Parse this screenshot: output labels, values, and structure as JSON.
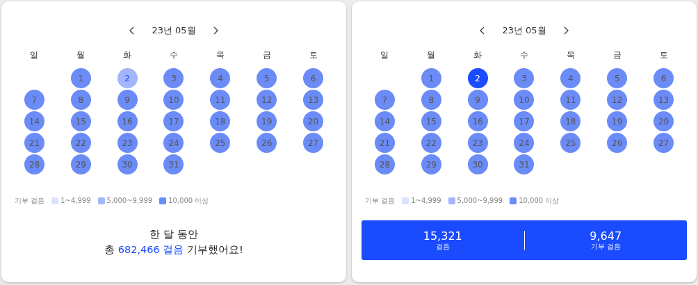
{
  "panels": [
    {
      "month": "23년 05월",
      "weekdays": [
        "일",
        "월",
        "화",
        "수",
        "목",
        "금",
        "토"
      ],
      "weeks": [
        [
          {
            "label": "1",
            "color": "#6b8bf7",
            "selected": false,
            "today": false
          },
          {
            "label": "2",
            "color": "#a3b5fb",
            "selected": false,
            "today": true
          },
          {
            "label": "3",
            "color": "#6b8bf7",
            "selected": false,
            "today": false
          },
          {
            "label": "4",
            "color": "#6b8bf7",
            "selected": false,
            "today": false
          },
          {
            "label": "5",
            "color": "#6b8bf7",
            "selected": false,
            "today": false
          },
          {
            "label": "6",
            "color": "#6b8bf7",
            "selected": false,
            "today": false
          }
        ],
        [
          {
            "label": "7",
            "color": "#6b8bf7",
            "selected": false,
            "today": false
          },
          {
            "label": "8",
            "color": "#6b8bf7",
            "selected": false,
            "today": false
          },
          {
            "label": "9",
            "color": "#6b8bf7",
            "selected": false,
            "today": false
          },
          {
            "label": "10",
            "color": "#6b8bf7",
            "selected": false,
            "today": false
          },
          {
            "label": "11",
            "color": "#6b8bf7",
            "selected": false,
            "today": false
          },
          {
            "label": "12",
            "color": "#6b8bf7",
            "selected": false,
            "today": false
          },
          {
            "label": "13",
            "color": "#6b8bf7",
            "selected": false,
            "today": false
          }
        ],
        [
          {
            "label": "14",
            "color": "#6b8bf7",
            "selected": false,
            "today": false
          },
          {
            "label": "15",
            "color": "#6b8bf7",
            "selected": false,
            "today": false
          },
          {
            "label": "16",
            "color": "#6b8bf7",
            "selected": false,
            "today": false
          },
          {
            "label": "17",
            "color": "#6b8bf7",
            "selected": false,
            "today": false
          },
          {
            "label": "18",
            "color": "#6b8bf7",
            "selected": false,
            "today": false
          },
          {
            "label": "19",
            "color": "#6b8bf7",
            "selected": false,
            "today": false
          },
          {
            "label": "20",
            "color": "#6b8bf7",
            "selected": false,
            "today": false
          }
        ],
        [
          {
            "label": "21",
            "color": "#6b8bf7",
            "selected": false,
            "today": false
          },
          {
            "label": "22",
            "color": "#6b8bf7",
            "selected": false,
            "today": false
          },
          {
            "label": "23",
            "color": "#6b8bf7",
            "selected": false,
            "today": false
          },
          {
            "label": "24",
            "color": "#6b8bf7",
            "selected": false,
            "today": false
          },
          {
            "label": "25",
            "color": "#6b8bf7",
            "selected": false,
            "today": false
          },
          {
            "label": "26",
            "color": "#6b8bf7",
            "selected": false,
            "today": false
          },
          {
            "label": "27",
            "color": "#6b8bf7",
            "selected": false,
            "today": false
          }
        ],
        [
          {
            "label": "28",
            "color": "#6b8bf7",
            "selected": false,
            "today": false
          },
          {
            "label": "29",
            "color": "#6b8bf7",
            "selected": false,
            "today": false
          },
          {
            "label": "30",
            "color": "#6b8bf7",
            "selected": false,
            "today": false
          },
          {
            "label": "31",
            "color": "#6b8bf7",
            "selected": false,
            "today": false
          }
        ]
      ],
      "legend": {
        "label": "기부 걸음",
        "items": [
          {
            "label": "1~4,999",
            "color": "#dbe3fd"
          },
          {
            "label": "5,000~9,999",
            "color": "#a3b5fb"
          },
          {
            "label": "10,000 이상",
            "color": "#6b8bf7"
          }
        ]
      },
      "summary": {
        "kind": "total",
        "line": "한 달 동안",
        "prefix": "총",
        "highlight": "682,466 걸음",
        "suffix": "기부했어요!"
      }
    },
    {
      "month": "23년 05월",
      "weekdays": [
        "일",
        "월",
        "화",
        "수",
        "목",
        "금",
        "토"
      ],
      "weeks": [
        [
          {
            "label": "1",
            "color": "#6b8bf7",
            "selected": false,
            "today": false
          },
          {
            "label": "2",
            "selected": true,
            "today": false
          },
          {
            "label": "3",
            "color": "#6b8bf7",
            "selected": false,
            "today": false
          },
          {
            "label": "4",
            "color": "#6b8bf7",
            "selected": false,
            "today": false
          },
          {
            "label": "5",
            "color": "#6b8bf7",
            "selected": false,
            "today": false
          },
          {
            "label": "6",
            "color": "#6b8bf7",
            "selected": false,
            "today": false
          }
        ],
        [
          {
            "label": "7",
            "color": "#6b8bf7",
            "selected": false,
            "today": false
          },
          {
            "label": "8",
            "color": "#6b8bf7",
            "selected": false,
            "today": false
          },
          {
            "label": "9",
            "color": "#6b8bf7",
            "selected": false,
            "today": false
          },
          {
            "label": "10",
            "color": "#6b8bf7",
            "selected": false,
            "today": false
          },
          {
            "label": "11",
            "color": "#6b8bf7",
            "selected": false,
            "today": false
          },
          {
            "label": "12",
            "color": "#6b8bf7",
            "selected": false,
            "today": false
          },
          {
            "label": "13",
            "color": "#6b8bf7",
            "selected": false,
            "today": false
          }
        ],
        [
          {
            "label": "14",
            "color": "#6b8bf7",
            "selected": false,
            "today": false
          },
          {
            "label": "15",
            "color": "#6b8bf7",
            "selected": false,
            "today": false
          },
          {
            "label": "16",
            "color": "#6b8bf7",
            "selected": false,
            "today": false
          },
          {
            "label": "17",
            "color": "#6b8bf7",
            "selected": false,
            "today": false
          },
          {
            "label": "18",
            "color": "#6b8bf7",
            "selected": false,
            "today": false
          },
          {
            "label": "19",
            "color": "#6b8bf7",
            "selected": false,
            "today": false
          },
          {
            "label": "20",
            "color": "#6b8bf7",
            "selected": false,
            "today": false
          }
        ],
        [
          {
            "label": "21",
            "color": "#6b8bf7",
            "selected": false,
            "today": false
          },
          {
            "label": "22",
            "color": "#6b8bf7",
            "selected": false,
            "today": false
          },
          {
            "label": "23",
            "color": "#6b8bf7",
            "selected": false,
            "today": false
          },
          {
            "label": "24",
            "color": "#6b8bf7",
            "selected": false,
            "today": false
          },
          {
            "label": "25",
            "color": "#6b8bf7",
            "selected": false,
            "today": false
          },
          {
            "label": "26",
            "color": "#6b8bf7",
            "selected": false,
            "today": false
          },
          {
            "label": "27",
            "color": "#6b8bf7",
            "selected": false,
            "today": false
          }
        ],
        [
          {
            "label": "28",
            "color": "#6b8bf7",
            "selected": false,
            "today": false
          },
          {
            "label": "29",
            "color": "#6b8bf7",
            "selected": false,
            "today": false
          },
          {
            "label": "30",
            "color": "#6b8bf7",
            "selected": false,
            "today": false
          },
          {
            "label": "31",
            "color": "#6b8bf7",
            "selected": false,
            "today": false
          }
        ]
      ],
      "legend": {
        "label": "기부 걸음",
        "items": [
          {
            "label": "1~4,999",
            "color": "#dbe3fd"
          },
          {
            "label": "5,000~9,999",
            "color": "#a3b5fb"
          },
          {
            "label": "10,000 이상",
            "color": "#6b8bf7"
          }
        ]
      },
      "summary": {
        "kind": "stats",
        "stats": [
          {
            "value": "15,321",
            "label": "걸음"
          },
          {
            "value": "9,647",
            "label": "기부 걸음"
          }
        ]
      }
    }
  ]
}
